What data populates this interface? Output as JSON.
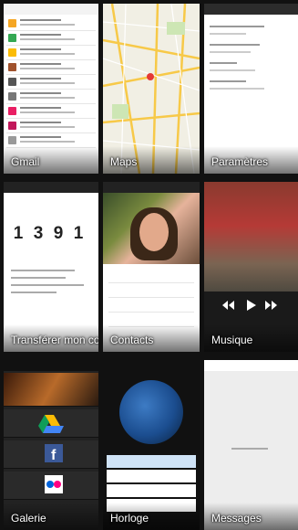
{
  "cards": [
    {
      "label": "Gmail"
    },
    {
      "label": "Maps"
    },
    {
      "label": "Paramètres"
    },
    {
      "label": "Transférer mon co..."
    },
    {
      "label": "Contacts"
    },
    {
      "label": "Musique"
    },
    {
      "label": "Galerie"
    },
    {
      "label": "Horloge"
    },
    {
      "label": "Messages"
    }
  ],
  "transfer": {
    "digits": [
      "1",
      "3",
      "9",
      "1"
    ]
  }
}
